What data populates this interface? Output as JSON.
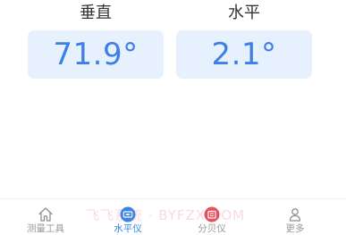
{
  "readings": {
    "vertical": {
      "label": "垂直",
      "value": "71.9°"
    },
    "horizontal": {
      "label": "水平",
      "value": "2.1°"
    }
  },
  "tabs": [
    {
      "label": "测量工具",
      "icon": "home-icon",
      "active": false
    },
    {
      "label": "水平仪",
      "icon": "level-icon",
      "active": true
    },
    {
      "label": "分贝仪",
      "icon": "decibel-icon",
      "active": false
    },
    {
      "label": "更多",
      "icon": "person-icon",
      "active": false
    }
  ],
  "watermark": "飞飞系统 · BYFZX.COM",
  "colors": {
    "accent": "#3d7fe8",
    "value_background": "#e7f1fd",
    "active_tab": "#2f87e6",
    "decibel_icon": "#e8505b",
    "inactive_tab": "#9a9a9a"
  }
}
